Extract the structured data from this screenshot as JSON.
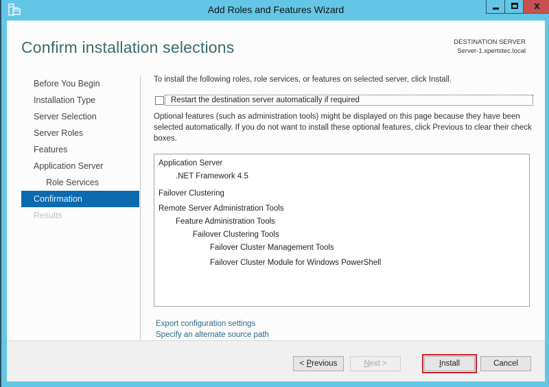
{
  "window": {
    "title": "Add Roles and Features Wizard",
    "app_icon": "server-manager-icon",
    "controls": {
      "minimize_icon": "minimize-icon",
      "maximize_icon": "maximize-icon",
      "close_label": "x"
    }
  },
  "header": {
    "page_title": "Confirm installation selections",
    "destination_label": "DESTINATION SERVER",
    "destination_value": "Server-1.xpertstec.local"
  },
  "nav": {
    "items": [
      {
        "label": "Before You Begin",
        "state": "normal"
      },
      {
        "label": "Installation Type",
        "state": "normal"
      },
      {
        "label": "Server Selection",
        "state": "normal"
      },
      {
        "label": "Server Roles",
        "state": "normal"
      },
      {
        "label": "Features",
        "state": "normal"
      },
      {
        "label": "Application Server",
        "state": "normal"
      },
      {
        "label": "Role Services",
        "state": "sub"
      },
      {
        "label": "Confirmation",
        "state": "active"
      },
      {
        "label": "Results",
        "state": "disabled"
      }
    ]
  },
  "content": {
    "intro": "To install the following roles, role services, or features on selected server, click Install.",
    "restart_checkbox": {
      "label": "Restart the destination server automatically if required",
      "checked": false
    },
    "optional_text": "Optional features (such as administration tools) might be displayed on this page because they have been selected automatically. If you do not want to install these optional features, click Previous to clear their check boxes.",
    "selections": [
      {
        "label": "Application Server",
        "level": 0
      },
      {
        "label": ".NET Framework 4.5",
        "level": 1
      },
      {
        "label": "Failover Clustering",
        "level": 0
      },
      {
        "label": "Remote Server Administration Tools",
        "level": 0
      },
      {
        "label": "Feature Administration Tools",
        "level": 1
      },
      {
        "label": "Failover Clustering Tools",
        "level": 2
      },
      {
        "label": "Failover Cluster Management Tools",
        "level": 3
      },
      {
        "label": "Failover Cluster Module for Windows PowerShell",
        "level": 3
      }
    ],
    "links": {
      "export": "Export configuration settings",
      "alternate_source": "Specify an alternate source path"
    }
  },
  "footer": {
    "previous_prefix": "< ",
    "previous_access": "P",
    "previous_rest": "revious",
    "next_access": "N",
    "next_rest": "ext >",
    "install_access": "I",
    "install_rest": "nstall",
    "cancel_label": "Cancel",
    "highlight_color": "#d0202a"
  }
}
